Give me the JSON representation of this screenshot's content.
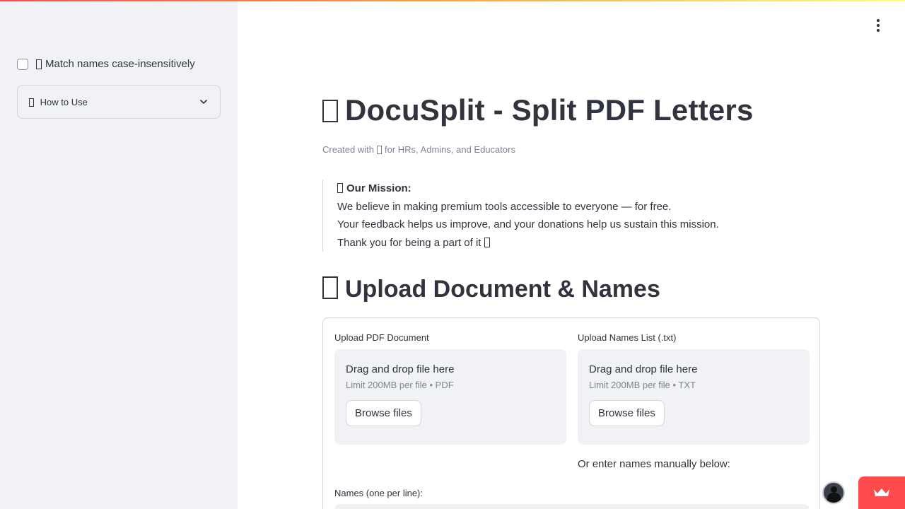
{
  "sidebar": {
    "checkbox": {
      "label": "Match names case-insensitively",
      "checked": false
    },
    "expander": {
      "label": "How to Use"
    }
  },
  "main": {
    "title": "DocuSplit - Split PDF Letters",
    "caption": {
      "prefix": "Created with",
      "suffix": "for HRs, Admins, and Educators"
    },
    "mission": {
      "heading": "Our Mission:",
      "line1": "We believe in making premium tools accessible to everyone — for free.",
      "line2": "Your feedback helps us improve, and your donations help us sustain this mission.",
      "line3": "Thank you for being a part of it"
    },
    "upload_heading": "Upload Document & Names",
    "pdf_uploader": {
      "label": "Upload PDF Document",
      "drop_text": "Drag and drop file here",
      "limit": "Limit 200MB per file • PDF",
      "button": "Browse files"
    },
    "names_uploader": {
      "label": "Upload Names List (.txt)",
      "drop_text": "Drag and drop file here",
      "limit": "Limit 200MB per file • TXT",
      "button": "Browse files"
    },
    "manual_hint": "Or enter names manually below:",
    "names_label": "Names (one per line):"
  },
  "colors": {
    "sidebar_bg": "#f0f2f6",
    "text": "#31333f",
    "muted": "#808495",
    "accent": "#ff4b4b"
  },
  "icons": {
    "menu": "kebab-menu-icon",
    "expander": "chevron-down-icon",
    "badge": "crown-icon"
  }
}
